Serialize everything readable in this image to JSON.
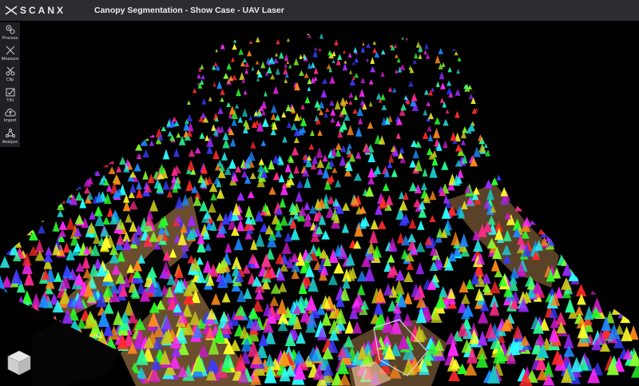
{
  "app": {
    "logo_text": "SCANX",
    "title": "Canopy Segmentation - Show Case - UAV Laser"
  },
  "toolbar": {
    "items": [
      {
        "label": "Process",
        "icon": "process-icon"
      },
      {
        "label": "Measure",
        "icon": "measure-icon"
      },
      {
        "label": "Clip",
        "icon": "clip-icon"
      },
      {
        "label": "TIN",
        "icon": "tin-icon"
      },
      {
        "label": "Import",
        "icon": "import-icon"
      },
      {
        "label": "Analyze",
        "icon": "analyze-icon"
      }
    ]
  },
  "viewport": {
    "ground_color": "#7a5a34",
    "segment_colors": [
      "#ff2a2a",
      "#2aff2a",
      "#3a3aff",
      "#ffff2a",
      "#ff2aff",
      "#2affff",
      "#ff8a1a",
      "#9a2aff",
      "#2aff9a",
      "#ff2a8a",
      "#8aff2a",
      "#1a8aff",
      "#c8c81a",
      "#1ac8c8",
      "#c81ac8"
    ]
  },
  "navcube": {
    "icon": "navigation-cube-icon"
  }
}
